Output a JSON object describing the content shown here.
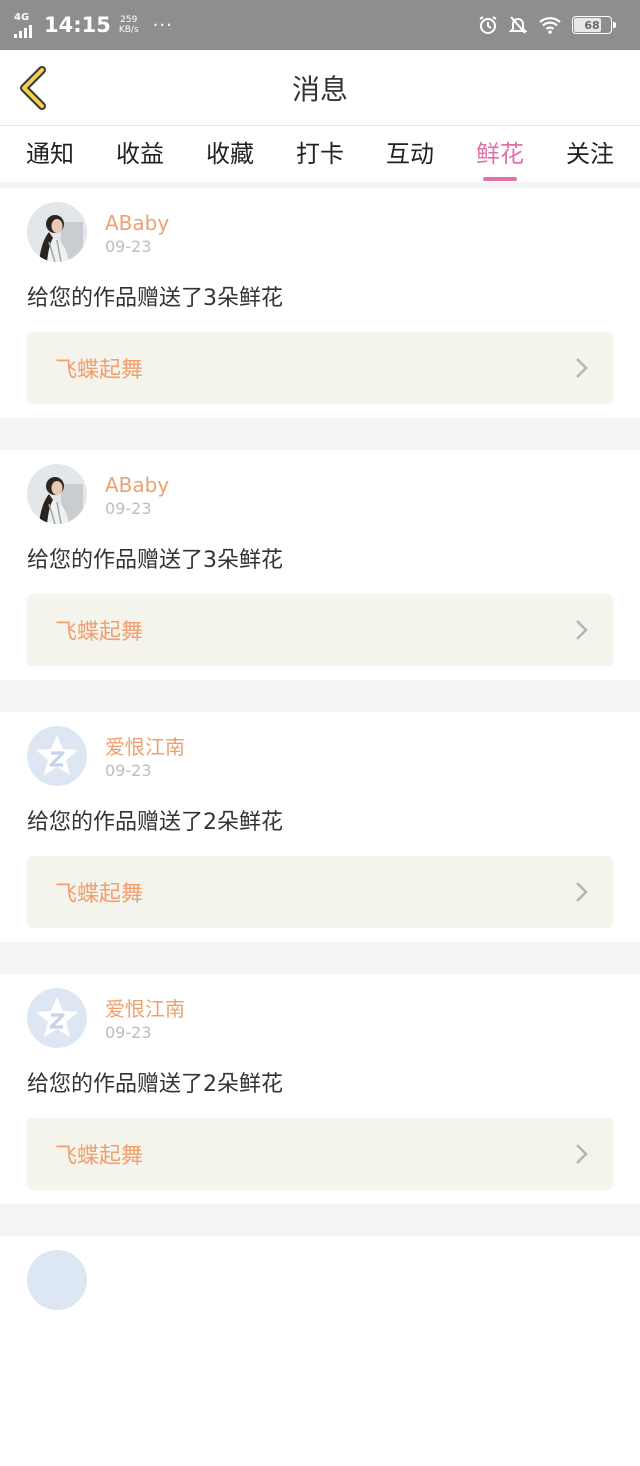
{
  "status_bar": {
    "network": "4G",
    "time": "14:15",
    "speed_value": "259",
    "speed_unit": "KB/s",
    "more": "···",
    "battery": "68"
  },
  "header": {
    "title": "消息",
    "back_icon": "chevron-left-icon"
  },
  "tabs": [
    {
      "label": "通知",
      "active": false
    },
    {
      "label": "收益",
      "active": false
    },
    {
      "label": "收藏",
      "active": false
    },
    {
      "label": "打卡",
      "active": false
    },
    {
      "label": "互动",
      "active": false
    },
    {
      "label": "鲜花",
      "active": true
    },
    {
      "label": "关注",
      "active": false
    }
  ],
  "messages": [
    {
      "user": "ABaby",
      "date": "09-23",
      "avatar": "photo-avatar",
      "text": "给您的作品赠送了3朵鲜花",
      "work": "飞蝶起舞"
    },
    {
      "user": "ABaby",
      "date": "09-23",
      "avatar": "photo-avatar",
      "text": "给您的作品赠送了3朵鲜花",
      "work": "飞蝶起舞"
    },
    {
      "user": "爱恨江南",
      "date": "09-23",
      "avatar": "star-z-avatar",
      "text": "给您的作品赠送了2朵鲜花",
      "work": "飞蝶起舞"
    },
    {
      "user": "爱恨江南",
      "date": "09-23",
      "avatar": "star-z-avatar",
      "text": "给您的作品赠送了2朵鲜花",
      "work": "飞蝶起舞"
    }
  ],
  "colors": {
    "accent": "#e270ab",
    "name": "#f0a070",
    "work_bg": "#f5f4ec"
  }
}
